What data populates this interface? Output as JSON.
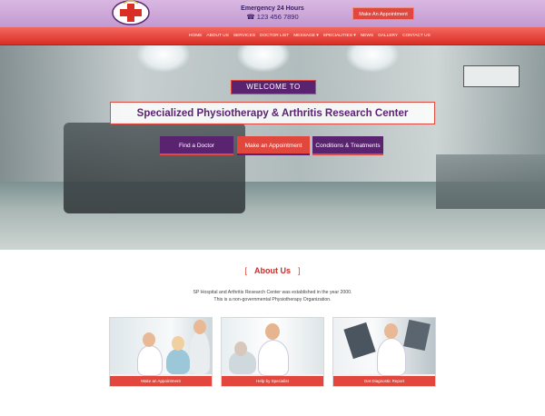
{
  "header": {
    "emergency_title": "Emergency 24 Hours",
    "phone": "☎ 123 456 7890",
    "appointment_button": "Make An Appointment"
  },
  "nav": {
    "items": [
      "HOME",
      "ABOUT US",
      "SERVICES",
      "DOCTOR LIST",
      "MESSAGE ▾",
      "SPECIALITIES ▾",
      "NEWS",
      "GALLERY",
      "CONTACT US"
    ]
  },
  "hero": {
    "welcome": "WELCOME TO",
    "title": "Specialized Physiotherapy & Arthritis Research Center",
    "buttons": {
      "find": "Find a Doctor",
      "make": "Make an Appointment",
      "conditions": "Conditions & Treatments"
    }
  },
  "about": {
    "bracket_left": "[",
    "title": "About Us",
    "bracket_right": "]",
    "line1": "SP Hospital and Arthritis Research Center was established in the year 2000.",
    "line2": "This is a non-governmental Physiotherapy Organization."
  },
  "cards": [
    {
      "caption": "Make an Appointment"
    },
    {
      "caption": "Help by Specialist"
    },
    {
      "caption": "Get Diagnostic Report"
    }
  ],
  "colors": {
    "purple": "#5a2370",
    "red": "#e2473e",
    "topbar": "#c29ad0"
  }
}
